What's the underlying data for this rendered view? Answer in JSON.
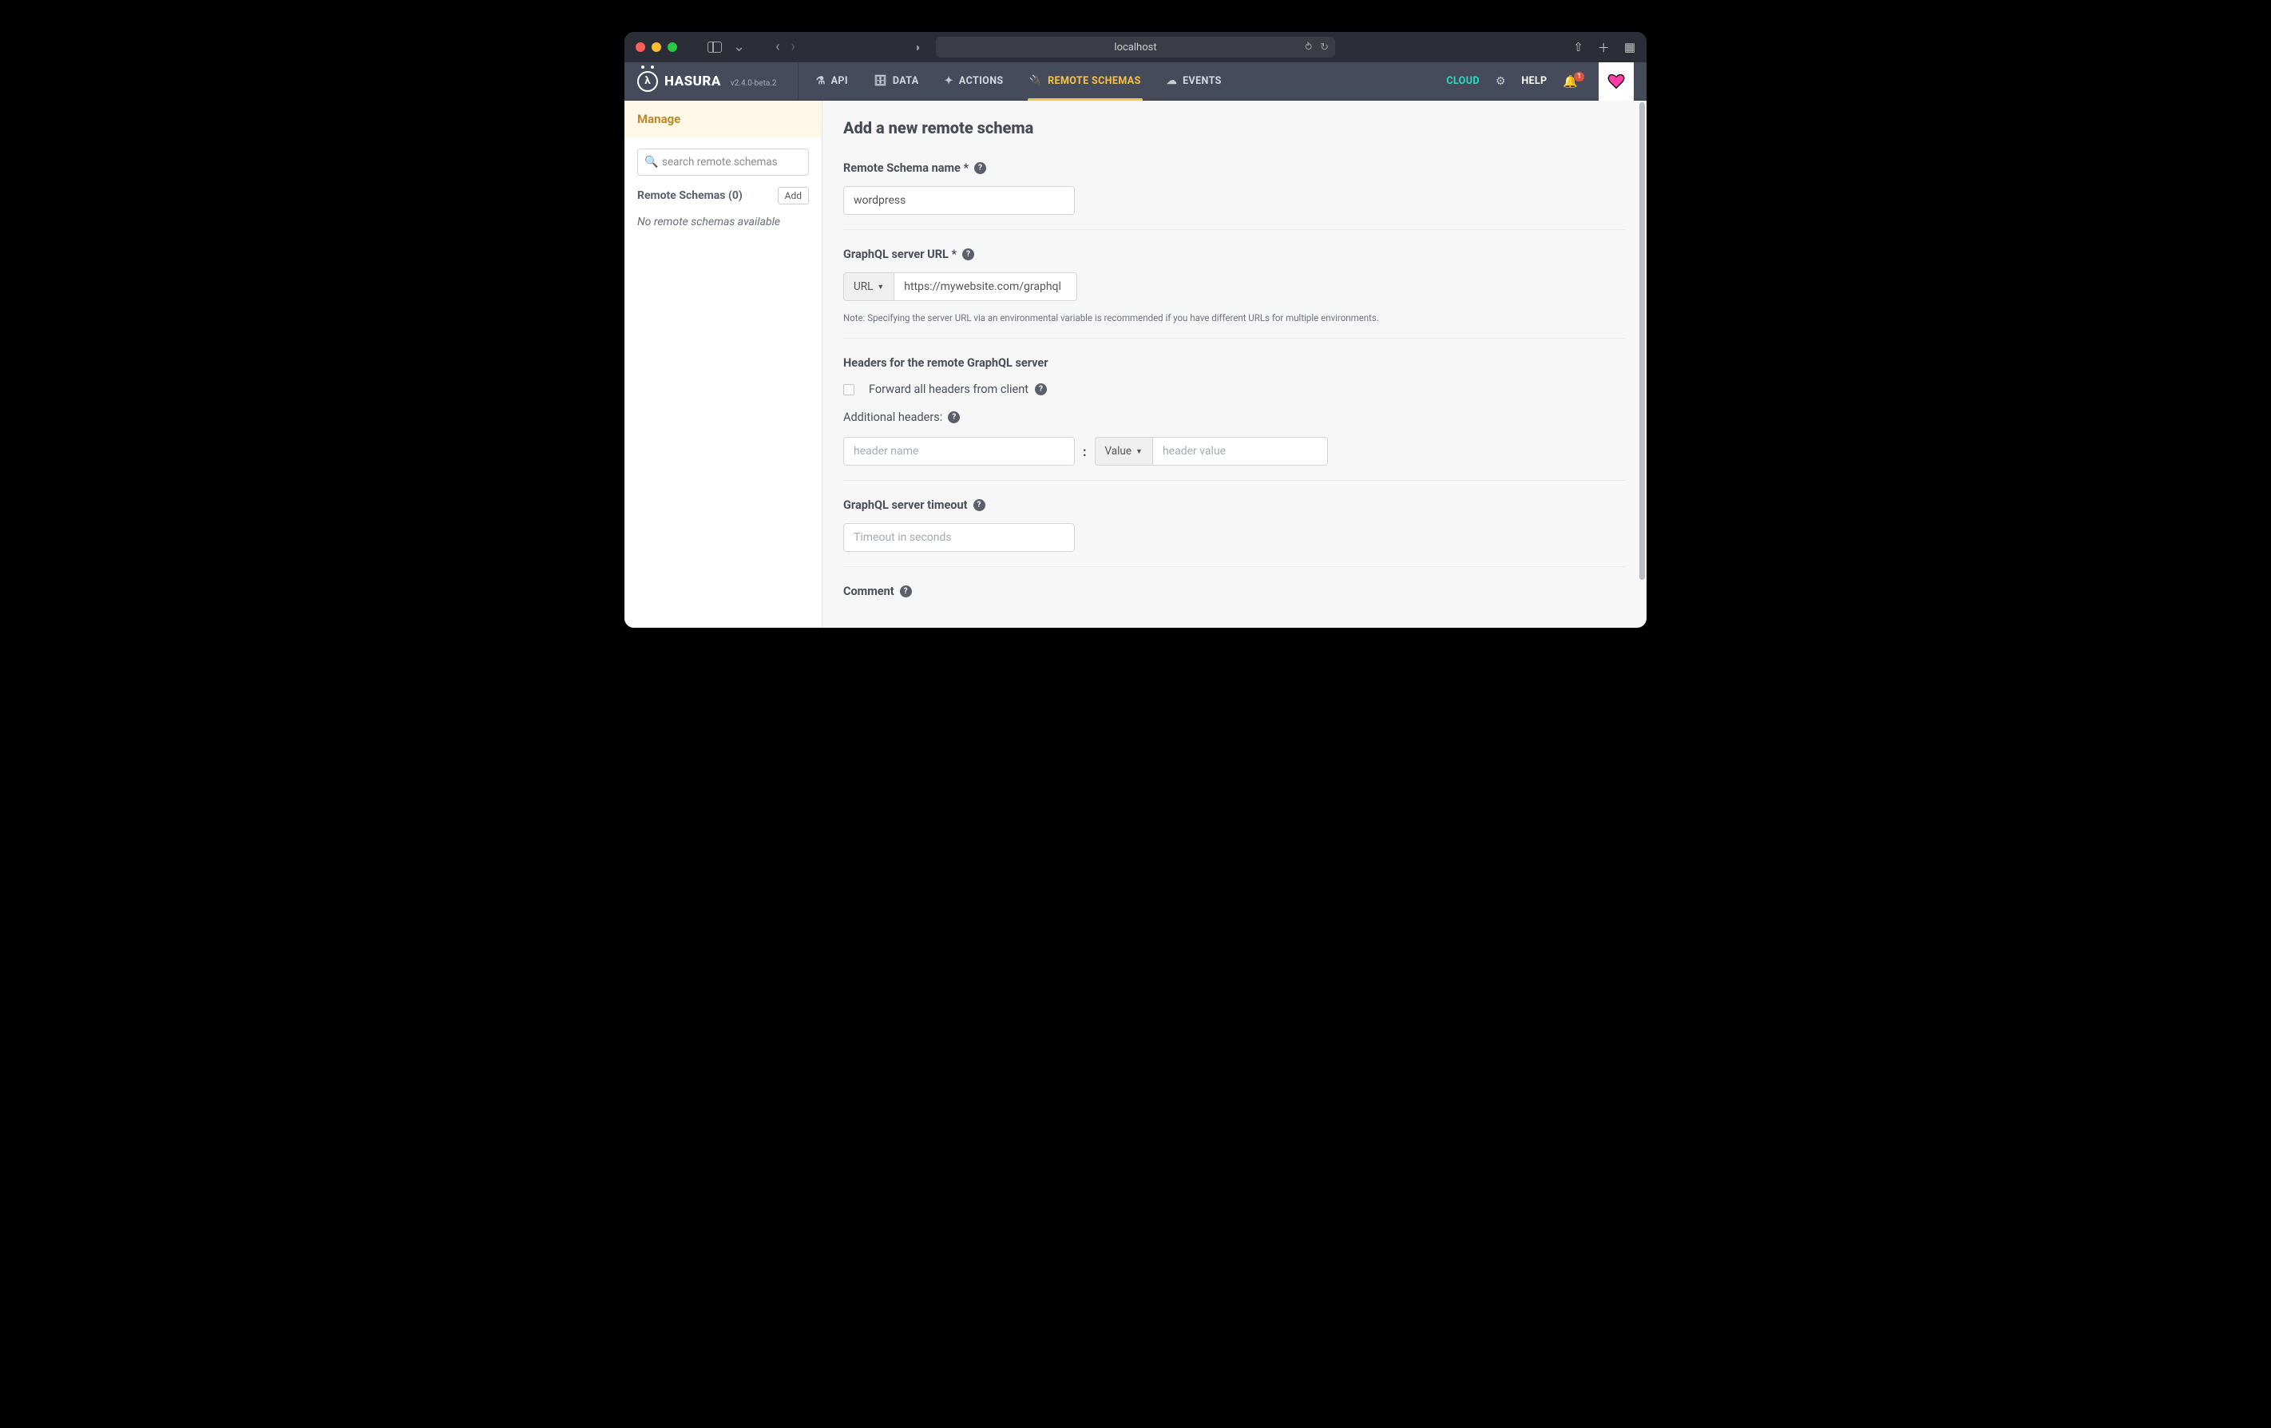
{
  "browser": {
    "url": "localhost"
  },
  "brand": {
    "name": "HASURA",
    "version": "v2.4.0-beta.2"
  },
  "nav": {
    "api": "API",
    "data": "DATA",
    "actions": "ACTIONS",
    "remote": "REMOTE SCHEMAS",
    "events": "EVENTS"
  },
  "navright": {
    "cloud": "CLOUD",
    "help": "HELP",
    "notif_count": "1"
  },
  "sidebar": {
    "manage": "Manage",
    "search_placeholder": "search remote schemas",
    "list_title": "Remote Schemas (0)",
    "add": "Add",
    "empty": "No remote schemas available"
  },
  "page": {
    "title": "Add a new remote schema",
    "name_label": "Remote Schema name *",
    "name_value": "wordpress",
    "url_label": "GraphQL server URL *",
    "url_prefix": "URL",
    "url_value": "https://mywebsite.com/graphql",
    "url_note": "Note: Specifying the server URL via an environmental variable is recommended if you have different URLs for multiple environments.",
    "headers_label": "Headers for the remote GraphQL server",
    "forward_label": "Forward all headers from client",
    "additional_label": "Additional headers:",
    "header_name_ph": "header name",
    "header_val_prefix": "Value",
    "header_val_ph": "header value",
    "timeout_label": "GraphQL server timeout",
    "timeout_ph": "Timeout in seconds",
    "comment_label": "Comment"
  }
}
